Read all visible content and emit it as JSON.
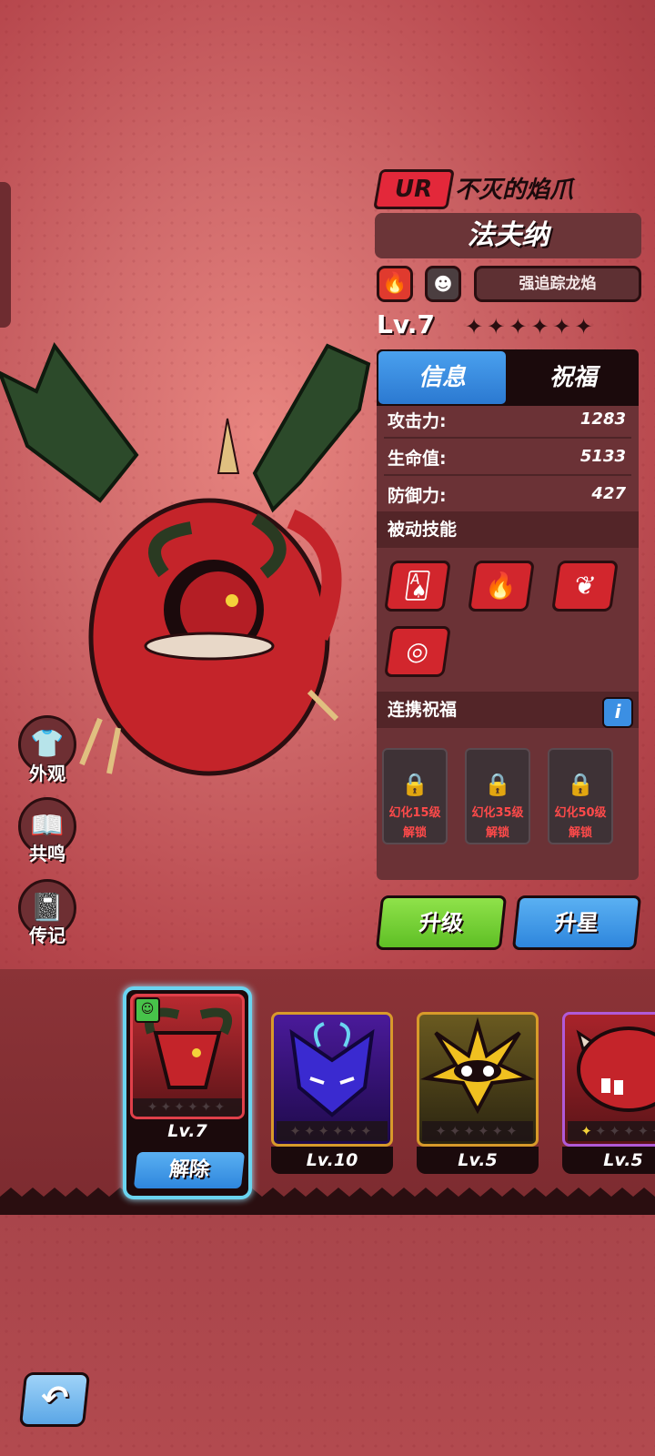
{
  "hero": {
    "rarity": "UR",
    "subtitle": "不灭的焰爪",
    "name": "法夫纳",
    "element_icon": "fire-icon",
    "type_icon": "demon-mask-icon",
    "signature_skill": "强追踪龙焰",
    "level": "Lv.7",
    "stars_total": 6,
    "stars_filled": 0
  },
  "tabs": {
    "info": "信息",
    "blessing": "祝福",
    "active": "info"
  },
  "stats": [
    {
      "label": "攻击力:",
      "value": "1283"
    },
    {
      "label": "生命值:",
      "value": "5133"
    },
    {
      "label": "防御力:",
      "value": "427"
    }
  ],
  "passive": {
    "title": "被动技能",
    "skills": [
      "cards-dice-icon",
      "fire-icon",
      "flame-claw-icon",
      "swirl-icon"
    ]
  },
  "bond": {
    "title": "连携祝福",
    "info_label": "i",
    "slots": [
      {
        "condition": "幻化15级",
        "status": "解锁"
      },
      {
        "condition": "幻化35级",
        "status": "解锁"
      },
      {
        "condition": "幻化50级",
        "status": "解锁"
      }
    ]
  },
  "actions": {
    "upgrade": "升级",
    "star_up": "升星"
  },
  "side_menu": [
    {
      "icon": "shirt-icon",
      "label": "外观"
    },
    {
      "icon": "book-icon",
      "label": "共鸣"
    },
    {
      "icon": "journal-icon",
      "label": "传记"
    }
  ],
  "roster": [
    {
      "level": "Lv.7",
      "selected": true,
      "action": "解除",
      "portrait": "red-demon",
      "frame_color": "#e0404a"
    },
    {
      "level": "Lv.10",
      "selected": false,
      "portrait": "purple-dragon",
      "frame_color": "#d89a2a"
    },
    {
      "level": "Lv.5",
      "selected": false,
      "portrait": "yellow-spike",
      "frame_color": "#d89a2a"
    },
    {
      "level": "Lv.5",
      "selected": false,
      "portrait": "red-beast",
      "frame_color": "#b05ad8"
    }
  ],
  "back_icon": "back-arrow-icon",
  "colors": {
    "accent_blue": "#2e86dd",
    "accent_green": "#5fbf25",
    "ur_red": "#e3283a"
  }
}
